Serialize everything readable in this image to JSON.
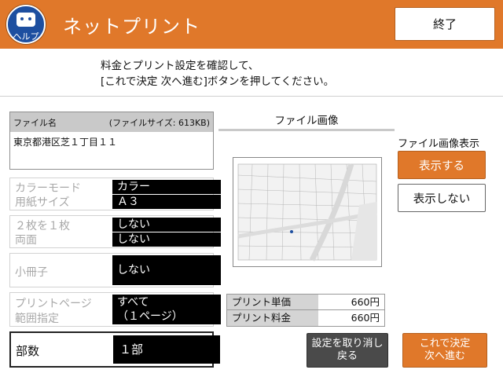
{
  "header": {
    "help_label": "ヘルプ",
    "title": "ネットプリント",
    "exit_label": "終了",
    "help_icon": "help-face-icon"
  },
  "instructions": {
    "line1": "料金とプリント設定を確認して、",
    "line2": "[これで決定 次へ進む]ボタンを押してください。"
  },
  "file": {
    "name_header": "ファイル名",
    "size_header": "(ファイルサイズ: 613KB)",
    "name_value": "東京都港区芝１丁目１１"
  },
  "settings": [
    {
      "labels": [
        "カラーモード",
        "用紙サイズ"
      ],
      "values": [
        "カラー",
        "Ａ３"
      ]
    },
    {
      "labels": [
        "２枚を１枚",
        "両面"
      ],
      "values": [
        "しない",
        "しない"
      ]
    },
    {
      "labels": [
        "小冊子"
      ],
      "values": [
        "しない"
      ]
    },
    {
      "labels": [
        "プリントページ",
        "範囲指定"
      ],
      "values": [
        "すべて",
        "（１ページ）"
      ]
    }
  ],
  "copies": {
    "label": "部数",
    "value": "１部"
  },
  "file_image": {
    "title": "ファイル画像",
    "display_label": "ファイル画像表示",
    "show_label": "表示する",
    "hide_label": "表示しない"
  },
  "price": {
    "unit_label": "プリント単価",
    "unit_value": "660円",
    "total_label": "プリント料金",
    "total_value": "660円"
  },
  "buttons": {
    "cancel_line1": "設定を取り消し",
    "cancel_line2": "戻る",
    "next_line1": "これで決定",
    "next_line2": "次へ進む"
  },
  "colors": {
    "accent": "#e0782a",
    "help_blue": "#1d4fa0",
    "dark_button": "#4a4a4a"
  }
}
